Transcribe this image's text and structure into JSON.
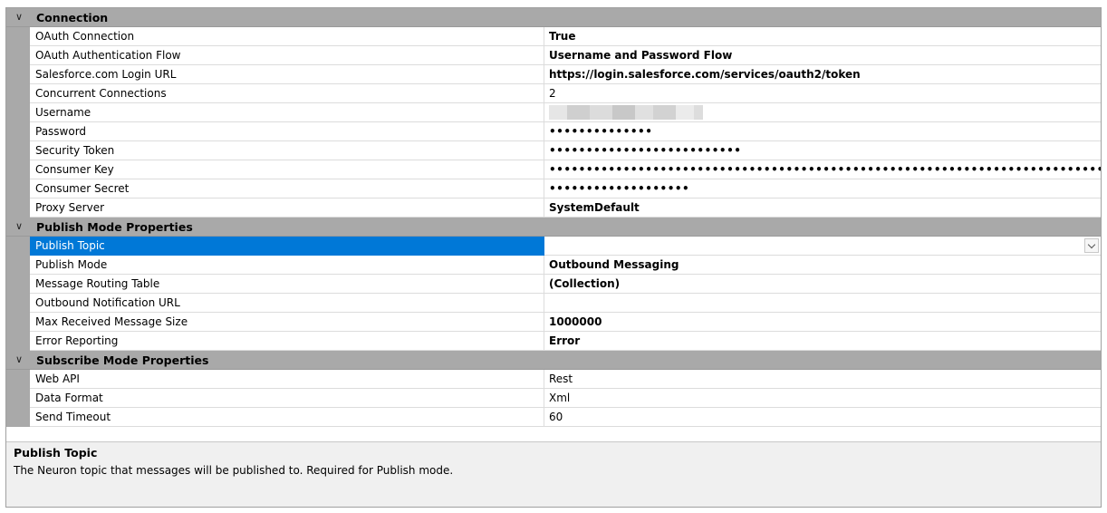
{
  "categories": [
    {
      "title": "Connection",
      "rows": [
        {
          "name": "OAuth Connection",
          "value": "True",
          "style": "bold"
        },
        {
          "name": "OAuth Authentication Flow",
          "value": "Username and Password Flow",
          "style": "bold"
        },
        {
          "name": "Salesforce.com Login URL",
          "value": "https://login.salesforce.com/services/oauth2/token",
          "style": "bold"
        },
        {
          "name": "Concurrent Connections",
          "value": "2",
          "style": "normal"
        },
        {
          "name": "Username",
          "value": "",
          "style": "blurred"
        },
        {
          "name": "Password",
          "value": "••••••••••••••",
          "style": "dots"
        },
        {
          "name": "Security Token",
          "value": "••••••••••••••••••••••••••",
          "style": "dots"
        },
        {
          "name": "Consumer Key",
          "value": "••••••••••••••••••••••••••••••••••••••••••••••••••••••••••••••••••••••••••••••••••••••••",
          "style": "dots"
        },
        {
          "name": "Consumer Secret",
          "value": "•••••••••••••••••••",
          "style": "dots"
        },
        {
          "name": "Proxy Server",
          "value": "SystemDefault",
          "style": "bold"
        }
      ]
    },
    {
      "title": "Publish Mode Properties",
      "rows": [
        {
          "name": "Publish Topic",
          "value": "",
          "style": "normal",
          "selected": true,
          "dropdown": true
        },
        {
          "name": "Publish Mode",
          "value": "Outbound Messaging",
          "style": "bold"
        },
        {
          "name": "Message Routing Table",
          "value": "(Collection)",
          "style": "bold"
        },
        {
          "name": "Outbound Notification URL",
          "value": "",
          "style": "normal"
        },
        {
          "name": "Max Received Message Size",
          "value": "1000000",
          "style": "bold"
        },
        {
          "name": "Error Reporting",
          "value": "Error",
          "style": "bold"
        }
      ]
    },
    {
      "title": "Subscribe Mode Properties",
      "rows": [
        {
          "name": "Web API",
          "value": "Rest",
          "style": "normal"
        },
        {
          "name": "Data Format",
          "value": "Xml",
          "style": "normal"
        },
        {
          "name": "Send Timeout",
          "value": "60",
          "style": "normal"
        }
      ]
    }
  ],
  "help": {
    "title": "Publish Topic",
    "description": "The Neuron topic that messages will be published to. Required for Publish mode."
  },
  "icons": {
    "category_toggle": "chevron-down-icon",
    "dropdown": "chevron-down-icon"
  },
  "colors": {
    "category_background": "#a9a9a9",
    "selection": "#0078d7",
    "help_background": "#f0f0f0"
  }
}
